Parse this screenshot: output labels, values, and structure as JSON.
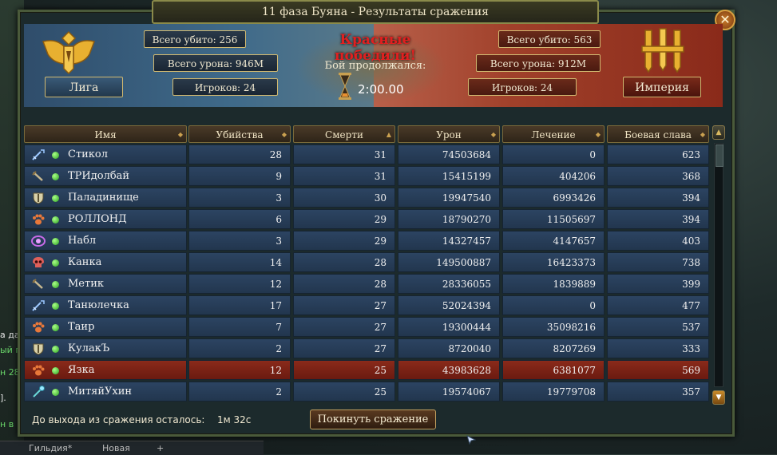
{
  "window": {
    "title": "11 фаза Буяна - Результаты сражения",
    "close_label": "✕"
  },
  "summary": {
    "result": "Красные победили!",
    "duration_label": "Бой продолжался:",
    "duration": "2:00.00",
    "left_team": {
      "name": "Лига",
      "kills": "Всего убито: 256",
      "damage": "Всего урона: 946M",
      "players": "Игроков: 24",
      "color": "#3f6a8a"
    },
    "right_team": {
      "name": "Империя",
      "kills": "Всего убито: 563",
      "damage": "Всего урона: 912M",
      "players": "Игроков: 24",
      "color": "#a0402a"
    }
  },
  "table": {
    "columns": [
      "Имя",
      "Убийства",
      "Смерти",
      "Урон",
      "Лечение",
      "Боевая слава"
    ],
    "sorted_column": "Смерти",
    "rows": [
      {
        "icon": "sword-icon",
        "name": "Стикол",
        "kills": "28",
        "deaths": "31",
        "damage": "74503684",
        "healing": "0",
        "glory": "623",
        "highlight": false
      },
      {
        "icon": "dagger-icon",
        "name": "ТРИдолбай",
        "kills": "9",
        "deaths": "31",
        "damage": "15415199",
        "healing": "404206",
        "glory": "368",
        "highlight": false
      },
      {
        "icon": "shield-icon",
        "name": "Паладинище",
        "kills": "3",
        "deaths": "30",
        "damage": "19947540",
        "healing": "6993426",
        "glory": "394",
        "highlight": false
      },
      {
        "icon": "paw-icon",
        "name": "РОЛЛОНД",
        "kills": "6",
        "deaths": "29",
        "damage": "18790270",
        "healing": "11505697",
        "glory": "394",
        "highlight": false
      },
      {
        "icon": "eye-icon",
        "name": "Набл",
        "kills": "3",
        "deaths": "29",
        "damage": "14327457",
        "healing": "4147657",
        "glory": "403",
        "highlight": false
      },
      {
        "icon": "skull-icon",
        "name": "Канка",
        "kills": "14",
        "deaths": "28",
        "damage": "149500887",
        "healing": "16423373",
        "glory": "738",
        "highlight": false
      },
      {
        "icon": "dagger-icon",
        "name": "Метик",
        "kills": "12",
        "deaths": "28",
        "damage": "28336055",
        "healing": "1839889",
        "glory": "399",
        "highlight": false
      },
      {
        "icon": "sword-icon",
        "name": "Танюлечка",
        "kills": "17",
        "deaths": "27",
        "damage": "52024394",
        "healing": "0",
        "glory": "477",
        "highlight": false
      },
      {
        "icon": "paw-icon",
        "name": "Таир",
        "kills": "7",
        "deaths": "27",
        "damage": "19300444",
        "healing": "35098216",
        "glory": "537",
        "highlight": false
      },
      {
        "icon": "shield-icon",
        "name": "КулакЪ",
        "kills": "2",
        "deaths": "27",
        "damage": "8720040",
        "healing": "8207269",
        "glory": "333",
        "highlight": false
      },
      {
        "icon": "paw-icon",
        "name": "Язка",
        "kills": "12",
        "deaths": "25",
        "damage": "43983628",
        "healing": "6381077",
        "glory": "569",
        "highlight": true
      },
      {
        "icon": "staff-icon",
        "name": "МитяйУхин",
        "kills": "2",
        "deaths": "25",
        "damage": "19574067",
        "healing": "19779708",
        "glory": "357",
        "highlight": false
      }
    ]
  },
  "footer": {
    "exit_label": "До выхода из сражения осталось:",
    "exit_time": "1м 32с",
    "leave_button": "Покинуть сражение"
  },
  "background": {
    "chat_lines": [
      "а да",
      "ый п",
      "н 28",
      "].",
      "н в"
    ],
    "chat_colors": [
      "#e8e8e8",
      "#6ad86a",
      "#6ad86a",
      "#e8e8e8",
      "#6ad86a"
    ],
    "tabs": [
      "Гильдия*",
      "Новая",
      "+"
    ]
  }
}
